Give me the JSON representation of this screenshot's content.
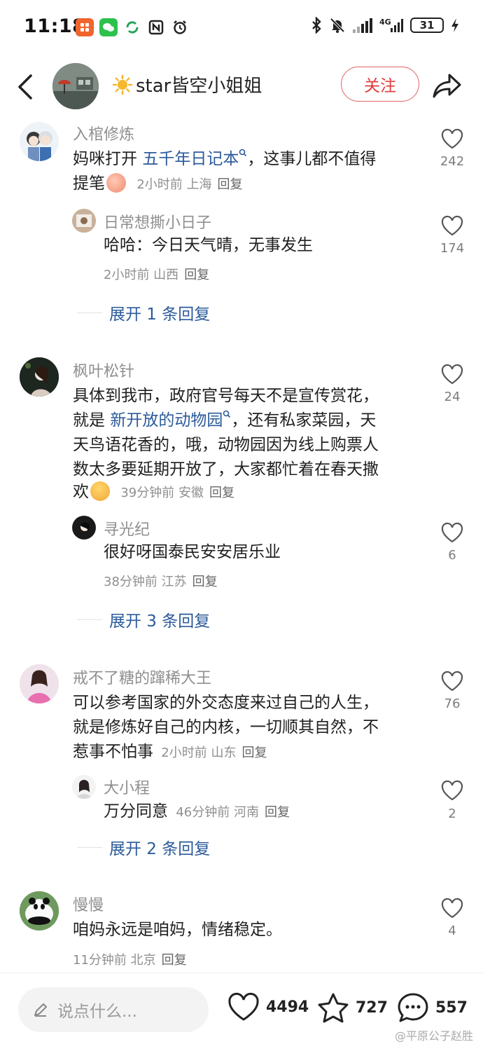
{
  "status_bar": {
    "time": "11:18",
    "battery": "31"
  },
  "header": {
    "title": "star皆空小姐姐",
    "follow_label": "关注"
  },
  "comments": [
    {
      "name": "入棺修炼",
      "text_before": "妈咪打开 ",
      "link": "五千年日记本",
      "text_after": "，这事儿都不值得",
      "text_line2": "提笔",
      "meta_time": "2小时前 上海",
      "reply_label": "回复",
      "likes": "242",
      "sub": {
        "name": "日常想撕小日子",
        "text": "哈哈：今日天气晴，无事发生",
        "meta_time": "2小时前 山西",
        "reply_label": "回复",
        "likes": "174"
      },
      "expand_label": "展开 1 条回复"
    },
    {
      "name": "枫叶松针",
      "line1": "具体到我市，政府官号每天不是宣传赏花，",
      "line2_before": "就是 ",
      "line2_link": "新开放的动物园",
      "line2_after": "，还有私家菜园，天",
      "line3": "天鸟语花香的，哦，动物园因为线上购票人",
      "line4": "数太多要延期开放了，大家都忙着在春天撒",
      "line5": "欢",
      "meta_time": "39分钟前 安徽",
      "reply_label": "回复",
      "likes": "24",
      "sub": {
        "name": "寻光纪",
        "text": "很好呀国泰民安安居乐业",
        "meta_time": "38分钟前 江苏",
        "reply_label": "回复",
        "likes": "6"
      },
      "expand_label": "展开 3 条回复"
    },
    {
      "name": "戒不了糖的蹿稀大王",
      "line1": "可以参考国家的外交态度来过自己的人生，",
      "line2": "就是修炼好自己的内核，一切顺其自然，不",
      "line3": "惹事不怕事",
      "meta_time": "2小时前 山东",
      "reply_label": "回复",
      "likes": "76",
      "sub": {
        "name": "大小程",
        "text": "万分同意",
        "meta_time": "46分钟前 河南",
        "reply_label": "回复",
        "likes": "2"
      },
      "expand_label": "展开 2 条回复"
    },
    {
      "name": "慢慢",
      "text": "咱妈永远是咱妈，情绪稳定。",
      "meta_time": "11分钟前 北京",
      "reply_label": "回复",
      "likes": "4"
    }
  ],
  "bottom_bar": {
    "placeholder": "说点什么...",
    "like_count": "4494",
    "star_count": "727",
    "comment_count": "557",
    "watermark": "@平原公子赵胜"
  },
  "icons": {
    "back": "back-arrow-icon",
    "share": "share-icon",
    "heart": "heart-icon",
    "star": "star-icon",
    "comment": "comment-icon",
    "pencil": "pencil-icon",
    "search_hint": "search-hint-icon"
  },
  "colors": {
    "accent_red": "#e03b3b",
    "link_blue": "#2c5b9a",
    "meta_gray": "#8f8f8f"
  }
}
